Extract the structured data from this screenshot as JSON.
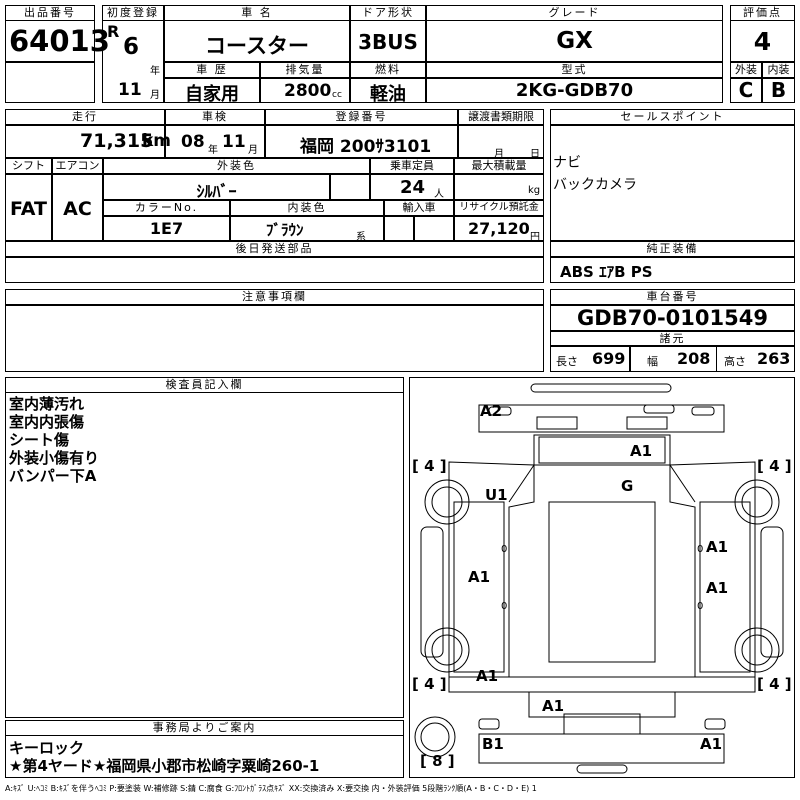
{
  "header": {
    "lot_no_label": "出品番号",
    "lot_no": "64013",
    "first_reg_label": "初度登録",
    "era": "R",
    "year": "6",
    "year_unit": "年",
    "month": "11",
    "month_unit": "月",
    "car_name_label": "車 名",
    "car_name": "コースター",
    "door_label": "ドア形状",
    "door": "3BUS",
    "grade_label": "グレード",
    "grade": "GX",
    "score_label": "評価点",
    "score": "4",
    "history_label": "車 歴",
    "history": "自家用",
    "displacement_label": "排気量",
    "displacement": "2800",
    "displacement_unit": "cc",
    "fuel_label": "燃料",
    "fuel": "軽油",
    "model_label": "型式",
    "model": "2KG-GDB70",
    "exterior_label": "外装",
    "exterior": "C",
    "interior_label": "内装",
    "interior": "B"
  },
  "row2": {
    "mileage_label": "走行",
    "mileage": "71,315",
    "mileage_unit": "km",
    "inspection_label": "車検",
    "insp_year": "08",
    "insp_year_unit": "年",
    "insp_month": "11",
    "insp_month_unit": "月",
    "plate_label": "登録番号",
    "plate": "福岡 200ｻ3101",
    "transfer_label": "譲渡書類期限",
    "transfer_month_unit": "月",
    "transfer_day_unit": "日",
    "sales_label": "セールスポイント",
    "sales_points": [
      "ナビ",
      "バックカメラ"
    ],
    "shift_label": "シフト",
    "shift": "FAT",
    "ac_label": "エアコン",
    "ac": "AC",
    "color_label": "外装色",
    "color": "ｼﾙﾊﾞｰ",
    "capacity_label": "乗車定員",
    "capacity": "24",
    "capacity_unit": "人",
    "max_load_label": "最大積載量",
    "max_load_unit": "kg",
    "color_no_label": "カラーNo.",
    "color_no": "1E7",
    "int_color_label": "内装色",
    "int_color": "ﾌﾞﾗｳﾝ",
    "int_color_unit": "系",
    "import_label": "輸入車",
    "recycle_label": "リサイクル預託金",
    "recycle": "27,120",
    "recycle_unit": "円",
    "later_parts_label": "後日発送部品",
    "genuine_label": "純正装備",
    "genuine": "ABS ｴｱB PS"
  },
  "notes": {
    "caution_label": "注意事項欄",
    "chassis_label": "車台番号",
    "chassis": "GDB70-0101549",
    "spec_label": "諸元",
    "length_label": "長さ",
    "length": "699",
    "width_label": "幅",
    "width": "208",
    "height_label": "高さ",
    "height": "263"
  },
  "inspector": {
    "label": "検査員記入欄",
    "lines": [
      "室内薄汚れ",
      "室内内張傷",
      "シート傷",
      "外装小傷有り",
      "バンパー下A"
    ]
  },
  "office": {
    "label": "事務局よりご案内",
    "lines": [
      "キーロック",
      "★第4ヤード★福岡県小郡市松崎字粟崎260-1"
    ]
  },
  "diagram": {
    "marks": {
      "a2": "A2",
      "a1_top": "A1",
      "g": "G",
      "u1": "U1",
      "a1_right1": "A1",
      "a1_left": "A1",
      "a1_right2": "A1",
      "a1_bottom_left": "A1",
      "a1_rear": "A1",
      "b1": "B1",
      "a1_rear_right": "A1"
    },
    "tire_tl": "[ 4 ]",
    "tire_tr": "[ 4 ]",
    "tire_bl": "[ 4 ]",
    "tire_br": "[ 4 ]",
    "spare": "[ 8 ]",
    "zero": "0"
  },
  "legend": "A:ｷｽﾞ U:ﾍｺﾐ B:ｷｽﾞを伴うﾍｺﾐ P:要塗装 W:補修跡 S:錆 C:腐食 G:ﾌﾛﾝﾄｶﾞﾗｽ点ｷｽﾞ XX:交換済み X:要交換 内・外装評価 5段階ﾗﾝｸ順(A・B・C・D・E) 1"
}
